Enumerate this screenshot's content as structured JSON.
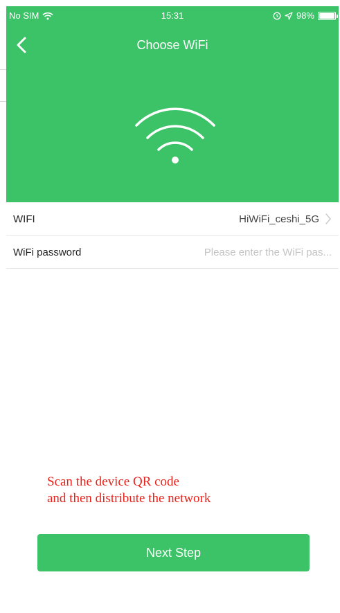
{
  "status_bar": {
    "carrier": "No SIM",
    "time": "15:31",
    "battery": "98%",
    "battery_level": 0.98
  },
  "nav": {
    "title": "Choose WiFi"
  },
  "form": {
    "wifi_label": "WIFI",
    "wifi_value": "HiWiFi_ceshi_5G",
    "password_label": "WiFi password",
    "password_placeholder": "Please enter the WiFi pas..."
  },
  "annotation": {
    "line1": "Scan the device QR code",
    "line2": "and then distribute the network"
  },
  "button": {
    "next_label": "Next Step"
  },
  "colors": {
    "accent": "#3cc368",
    "annotation": "#e8221c"
  },
  "icons": [
    "wifi-signal-icon",
    "back-chevron-icon",
    "alarm-icon",
    "location-arrow-icon",
    "battery-icon",
    "wifi-hero-icon",
    "chevron-right-icon"
  ]
}
